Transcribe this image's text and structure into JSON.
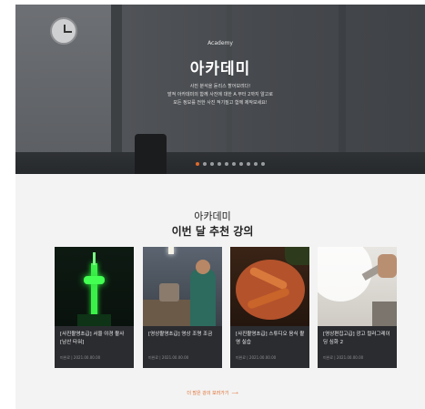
{
  "hero": {
    "subtitle": "Academy",
    "title": "아카데미",
    "desc_lines": [
      "사진 분석을 듣리스 할어보려다!",
      "발적 아카데미의 함께 사진에 대한 A 부터 2까지 알고로",
      "모든 정보를 전한 사진 적기질고 함께 제작보세요!"
    ],
    "slide_count": 10,
    "active_slide": 1
  },
  "section": {
    "category": "아카데미",
    "title": "이번 달 추천 강의"
  },
  "cards": [
    {
      "title": "[사진촬영초급] 서울 야경 촬사 [남산 타워]",
      "meta": "미완료  |  2021.00.00.00"
    },
    {
      "title": "[영상촬영초급] 영상 조명 조금",
      "meta": "미완료  |  2021.00.00.00"
    },
    {
      "title": "[사진촬영초급] 스튜디오 음식 촬영 실습",
      "meta": "미완료  |  2021.00.00.00"
    },
    {
      "title": "[영상편집고급] 광고 컬러그레이딩 심화 2",
      "meta": "미완료  |  2021.00.00.00"
    }
  ],
  "more_link": {
    "label": "더 많은 강의 보러가기",
    "arrow": "⟶"
  },
  "colors": {
    "accent": "#e06a2a",
    "card_bg": "#2b2c30",
    "section_bg": "#f3f3f3"
  }
}
